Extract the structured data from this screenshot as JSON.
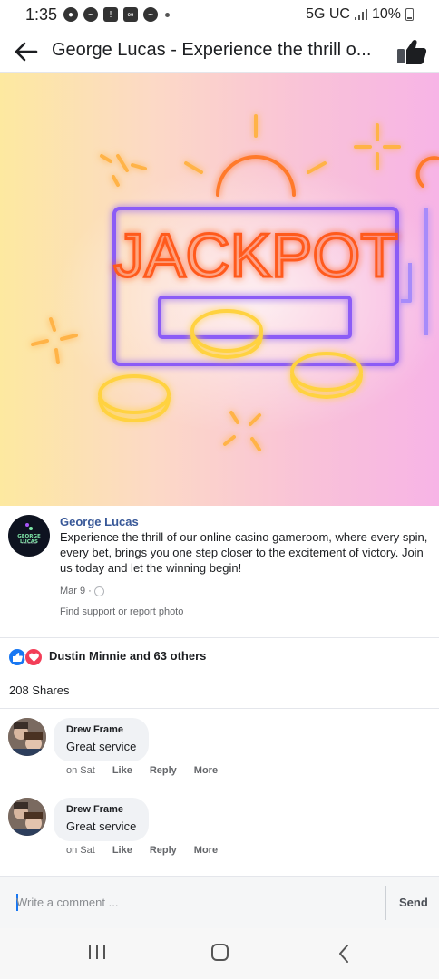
{
  "status_bar": {
    "time": "1:35",
    "network": "5G UC",
    "battery": "10%"
  },
  "header": {
    "title": "George Lucas - Experience the thrill o..."
  },
  "photo": {
    "neon_text": "JACKPOT"
  },
  "post": {
    "author": "George Lucas",
    "avatar_logo_text": "GEORGE LUCAS",
    "avatar_logo_subtext": "PLAYROOM",
    "caption": "Experience the thrill of our online casino gameroom, where every spin, every bet, brings you one step closer to the excitement of victory. Join us today and let the winning begin!",
    "date": "Mar 9",
    "separator": "·",
    "find_support": "Find support or report photo"
  },
  "reactions": {
    "summary": "Dustin Minnie and 63 others"
  },
  "shares": {
    "label": "208 Shares"
  },
  "comments": [
    {
      "name": "Drew Frame",
      "text": "Great service",
      "time": "on Sat",
      "like": "Like",
      "reply": "Reply",
      "more": "More"
    },
    {
      "name": "Drew Frame",
      "text": "Great service",
      "time": "on Sat",
      "like": "Like",
      "reply": "Reply",
      "more": "More"
    }
  ],
  "composer": {
    "placeholder": "Write a comment ...",
    "send": "Send"
  },
  "colors": {
    "link_blue": "#385898",
    "fb_blue": "#1877f2",
    "love_red": "#f33e58"
  }
}
